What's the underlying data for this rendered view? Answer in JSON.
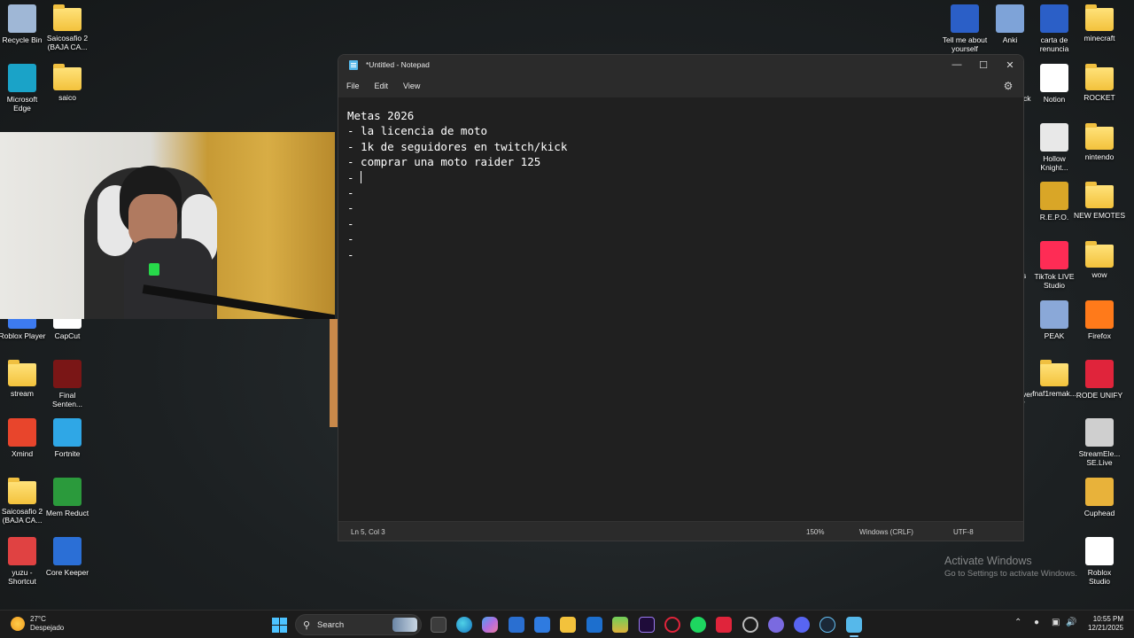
{
  "desktop": {
    "icons": [
      {
        "label": "Recycle Bin",
        "icon": "recycle-bin-icon",
        "color": "#9fb7d6"
      },
      {
        "label": "Saicosafio 2\n(BAJA CA...",
        "icon": "folder-icon",
        "color": "#f3c23c"
      },
      {
        "label": "Microsoft\nEdge",
        "icon": "edge-icon",
        "color": "#1aa3c8"
      },
      {
        "label": "saico",
        "icon": "folder-icon",
        "color": "#f3c23c"
      },
      {
        "label": "Roblox Player",
        "icon": "roblox-icon",
        "color": "#3d7bf0"
      },
      {
        "label": "CapCut",
        "icon": "capcut-icon",
        "color": "#ffffff"
      },
      {
        "label": "stream",
        "icon": "folder-icon",
        "color": "#f3c23c"
      },
      {
        "label": "Final\nSenten...",
        "icon": "final-sentence-icon",
        "color": "#7a1616"
      },
      {
        "label": "Xmind",
        "icon": "xmind-icon",
        "color": "#e8452c"
      },
      {
        "label": "Fortnite",
        "icon": "fortnite-icon",
        "color": "#2fa7e6"
      },
      {
        "label": "Saicosafio 2\n(BAJA CA...",
        "icon": "folder-icon",
        "color": "#f3c23c"
      },
      {
        "label": "Mem Reduct",
        "icon": "mem-reduct-icon",
        "color": "#2b9a3c"
      },
      {
        "label": "yuzu -\nShortcut",
        "icon": "yuzu-icon",
        "color": "#e04242"
      },
      {
        "label": "Core Keeper",
        "icon": "core-keeper-icon",
        "color": "#2b6fd6"
      },
      {
        "label": "Tell me about\nyourself",
        "icon": "word-doc-icon",
        "color": "#2b5fc7"
      },
      {
        "label": "Anki",
        "icon": "anki-icon",
        "color": "#7ea3d8"
      },
      {
        "label": "carta de\nrenuncia",
        "icon": "word-doc-icon",
        "color": "#2b5fc7"
      },
      {
        "label": "minecraft",
        "icon": "folder-icon",
        "color": "#f3c23c"
      },
      {
        "label": "Notion",
        "icon": "notion-icon",
        "color": "#ffffff"
      },
      {
        "label": "ROCKET",
        "icon": "folder-icon",
        "color": "#f3c23c"
      },
      {
        "label": "Hollow\nKnight...",
        "icon": "hollow-knight-icon",
        "color": "#e8e8e8"
      },
      {
        "label": "nintendo",
        "icon": "folder-icon",
        "color": "#f3c23c"
      },
      {
        "label": "R.E.P.O.",
        "icon": "repo-icon",
        "color": "#d9a627"
      },
      {
        "label": "NEW EMOTES",
        "icon": "folder-icon",
        "color": "#f3c23c"
      },
      {
        "label": "TikTok LIVE\nStudio",
        "icon": "tiktok-live-icon",
        "color": "#fe2c55"
      },
      {
        "label": "wow",
        "icon": "folder-icon",
        "color": "#f3c23c"
      },
      {
        "label": "PEAK",
        "icon": "peak-icon",
        "color": "#8aa8d8"
      },
      {
        "label": "Firefox",
        "icon": "firefox-icon",
        "color": "#ff7a1a"
      },
      {
        "label": "fnaf1remak...",
        "icon": "folder-icon",
        "color": "#f3c23c"
      },
      {
        "label": "RODE UNIFY",
        "icon": "rode-unify-icon",
        "color": "#e0243b"
      },
      {
        "label": "StreamEle...\nSE.Live",
        "icon": "streamelements-icon",
        "color": "#cfcfcf"
      },
      {
        "label": "Cuphead",
        "icon": "cuphead-icon",
        "color": "#e8b23a"
      },
      {
        "label": "Roblox\nStudio",
        "icon": "roblox-studio-icon",
        "color": "#ffffff"
      }
    ],
    "partial_labels": {
      "label_a": "ck",
      "label_b": "s",
      "label_c": "ver",
      "label_d": "r"
    }
  },
  "notepad": {
    "title": "*Untitled - Notepad",
    "menus": [
      "File",
      "Edit",
      "View"
    ],
    "lines": [
      "Metas 2026",
      "- la licencia de moto",
      "- 1k de seguidores en twitch/kick",
      "- comprar una moto raider 125",
      "- ",
      "-",
      "-",
      "-",
      "-",
      "-"
    ],
    "status": {
      "position": "Ln 5, Col 3",
      "zoom": "150%",
      "line_ending": "Windows (CRLF)",
      "encoding": "UTF-8"
    }
  },
  "watermark": {
    "title": "Activate Windows",
    "subtitle": "Go to Settings to activate Windows."
  },
  "taskbar": {
    "weather_temp": "27°C",
    "weather_desc": "Despejado",
    "search_label": "Search",
    "time": "10:55 PM",
    "date": "12/21/2025"
  }
}
